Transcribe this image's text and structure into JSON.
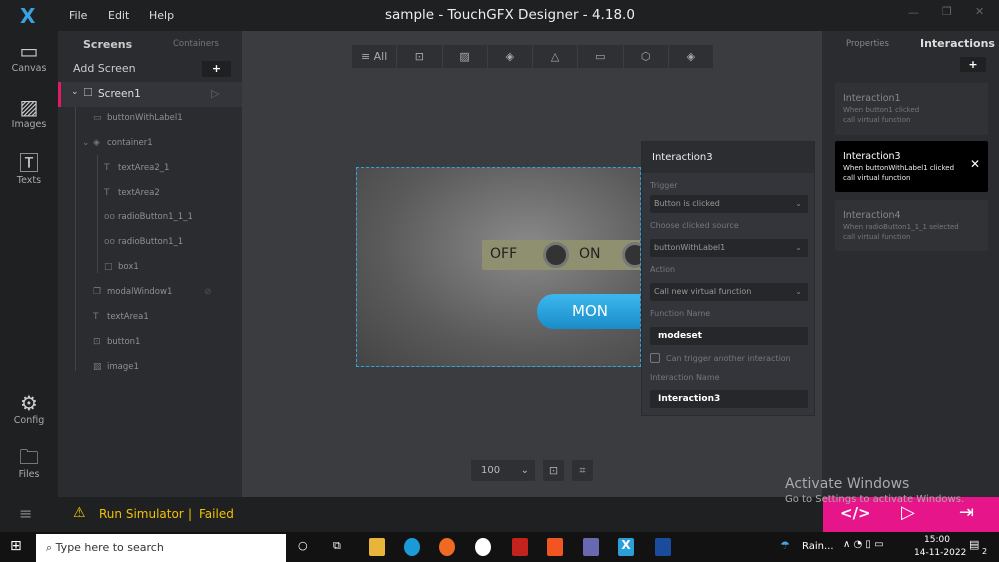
{
  "titlebar": {
    "title": "sample - TouchGFX Designer - 4.18.0",
    "menu": [
      "File",
      "Edit",
      "Help"
    ]
  },
  "rail": [
    {
      "label": "Canvas",
      "icon": "canvas-icon"
    },
    {
      "label": "Images",
      "icon": "image-icon"
    },
    {
      "label": "Texts",
      "icon": "text-icon"
    },
    {
      "label": "Config",
      "icon": "gear-icon"
    },
    {
      "label": "Files",
      "icon": "folder-icon"
    }
  ],
  "tree": {
    "tabs": [
      "Screens",
      "Containers"
    ],
    "add_screen": "Add Screen",
    "screen": "Screen1",
    "items": [
      "buttonWithLabel1",
      "container1",
      "textArea2_1",
      "textArea2",
      "radioButton1_1_1",
      "radioButton1_1",
      "box1",
      "modalWindow1",
      "textArea1",
      "button1",
      "image1"
    ]
  },
  "toolbar": {
    "all": "All"
  },
  "preview": {
    "off": "OFF",
    "on": "ON",
    "mon": "MON"
  },
  "zoom": {
    "value": "100"
  },
  "right": {
    "tabs": [
      "Properties",
      "Interactions"
    ],
    "cards": [
      {
        "title": "Interaction1",
        "line1": "When button1 clicked",
        "line2": "call virtual function"
      },
      {
        "title": "Interaction3",
        "line1": "When buttonWithLabel1 clicked",
        "line2": "call virtual function"
      },
      {
        "title": "Interaction4",
        "line1": "When radioButton1_1_1 selected",
        "line2": "call virtual function"
      }
    ]
  },
  "popup": {
    "title": "Interaction3",
    "trigger_label": "Trigger",
    "trigger": "Button is clicked",
    "source_label": "Choose clicked source",
    "source": "buttonWithLabel1",
    "action_label": "Action",
    "action": "Call new virtual function",
    "fn_label": "Function Name",
    "fn": "modeset",
    "chain": "Can trigger another interaction",
    "name_label": "Interaction Name",
    "name": "Interaction3"
  },
  "status": {
    "run": "Run Simulator",
    "sep": "|",
    "result": "Failed"
  },
  "watermark": {
    "line1": "Activate Windows",
    "line2": "Go to Settings to activate Windows."
  },
  "taskbar": {
    "search": "Type here to search",
    "weather": "Rain...",
    "time": "15:00",
    "date": "14-11-2022",
    "notif": "2"
  }
}
